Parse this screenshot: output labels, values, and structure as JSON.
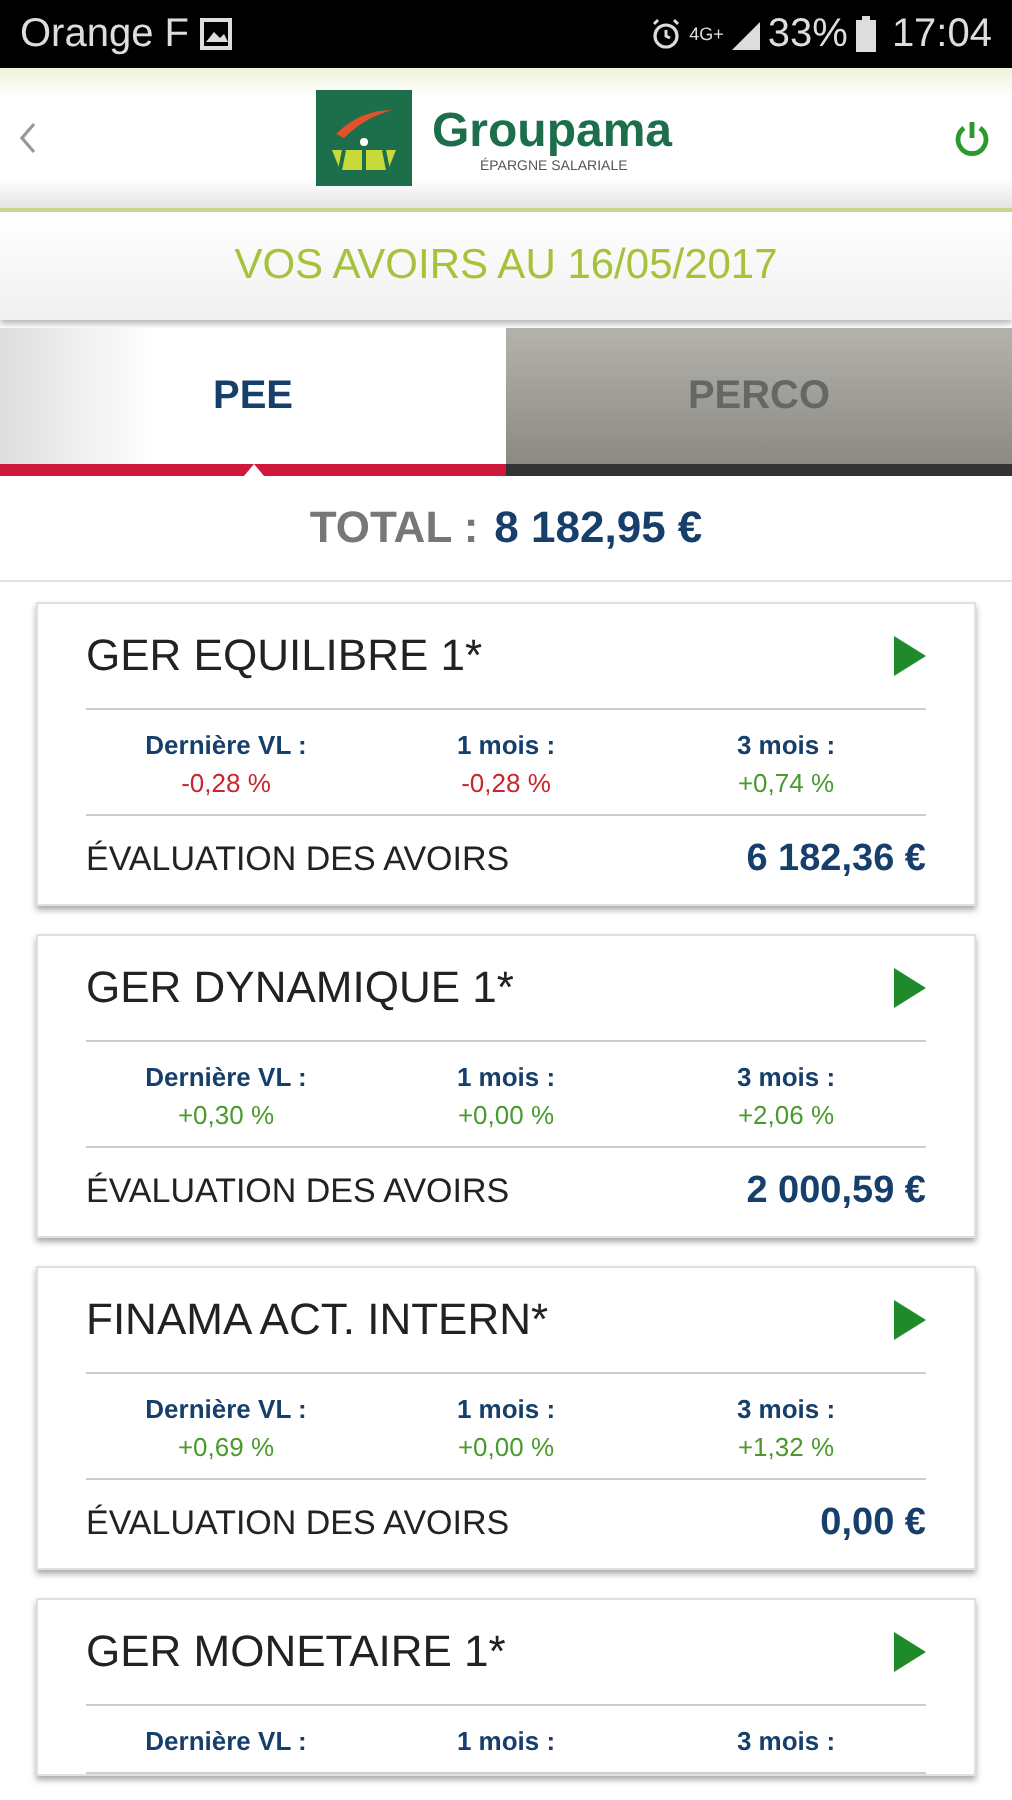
{
  "status_bar": {
    "carrier": "Orange F",
    "network": "4G+",
    "battery": "33%",
    "time": "17:04"
  },
  "header": {
    "brand": "Groupama",
    "subtitle": "ÉPARGNE SALARIALE"
  },
  "banner": "VOS AVOIRS AU 16/05/2017",
  "tabs": [
    {
      "label": "PEE",
      "selected": true
    },
    {
      "label": "PERCO",
      "selected": false
    }
  ],
  "total": {
    "label": "TOTAL :",
    "value": "8 182,95 €"
  },
  "funds": [
    {
      "name": "GER EQUILIBRE 1*",
      "stats": [
        {
          "label": "Dernière VL :",
          "value": "-0,28 %",
          "color": "#c8262e"
        },
        {
          "label": "1 mois :",
          "value": "-0,28 %",
          "color": "#c8262e"
        },
        {
          "label": "3 mois :",
          "value": "+0,74 %",
          "color": "#4a9a2e"
        }
      ],
      "evaluation_label": "ÉVALUATION DES AVOIRS",
      "evaluation": "6 182,36 €"
    },
    {
      "name": "GER DYNAMIQUE 1*",
      "stats": [
        {
          "label": "Dernière VL :",
          "value": "+0,30 %",
          "color": "#4a9a2e"
        },
        {
          "label": "1 mois :",
          "value": "+0,00 %",
          "color": "#4a9a2e"
        },
        {
          "label": "3 mois :",
          "value": "+2,06 %",
          "color": "#4a9a2e"
        }
      ],
      "evaluation_label": "ÉVALUATION DES AVOIRS",
      "evaluation": "2 000,59 €"
    },
    {
      "name": "FINAMA ACT. INTERN*",
      "stats": [
        {
          "label": "Dernière VL :",
          "value": "+0,69 %",
          "color": "#4a9a2e"
        },
        {
          "label": "1 mois :",
          "value": "+0,00 %",
          "color": "#4a9a2e"
        },
        {
          "label": "3 mois :",
          "value": "+1,32 %",
          "color": "#4a9a2e"
        }
      ],
      "evaluation_label": "ÉVALUATION DES AVOIRS",
      "evaluation": "0,00 €"
    },
    {
      "name": "GER MONETAIRE 1*",
      "stats": [
        {
          "label": "Dernière VL :"
        },
        {
          "label": "1 mois :"
        },
        {
          "label": "3 mois :"
        }
      ]
    }
  ]
}
